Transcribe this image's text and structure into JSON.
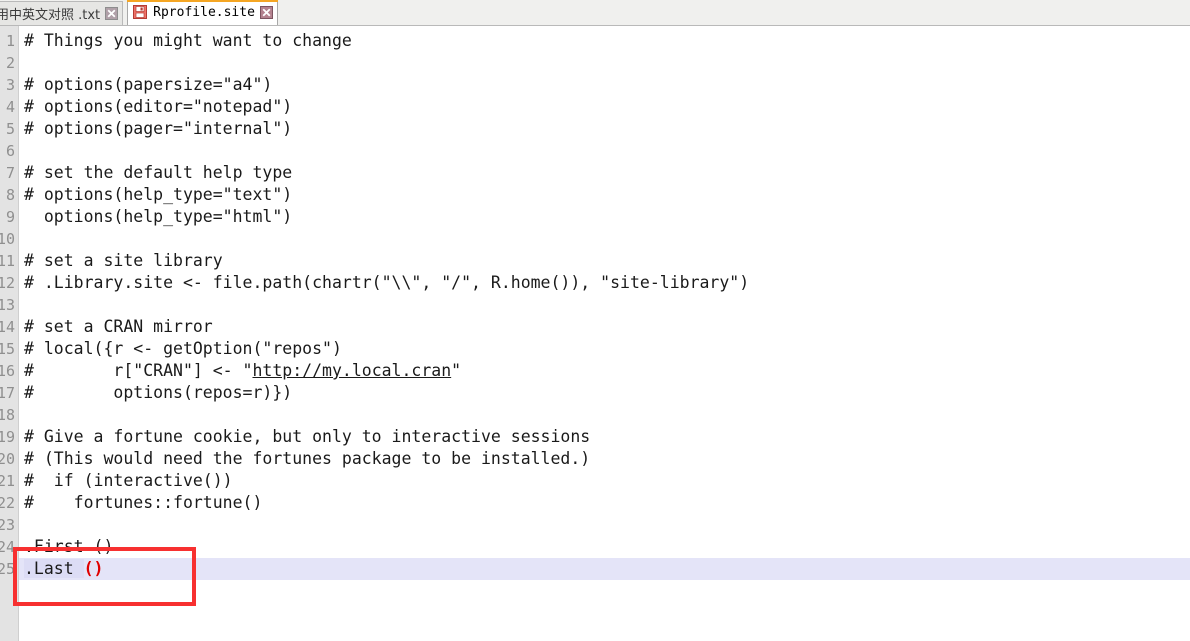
{
  "window": {
    "app_kind": "text-editor",
    "colors": {
      "active_tab_top_accent": "#f5a623",
      "current_line_highlight": "#e4e4f8",
      "selection": "#dcdcf5",
      "gutter_background": "#e3e3e3",
      "line_number_text": "#8f8f8f",
      "annotation_box": "#f73030",
      "matching_paren": "#e00000",
      "code_text": "#1a1a1a"
    }
  },
  "tabbar": {
    "tabs": [
      {
        "label": "用中英文对照 .txt",
        "active": false,
        "clipped_left": true,
        "close_icon": "close-icon",
        "close_label": "✕"
      },
      {
        "label": "Rprofile.site",
        "active": true,
        "clipped_left": false,
        "file_icon": "save-icon",
        "close_icon": "close-icon",
        "close_label": "✕"
      }
    ]
  },
  "editor": {
    "line_numbers": [
      "1",
      "2",
      "3",
      "4",
      "5",
      "6",
      "7",
      "8",
      "9",
      "10",
      "11",
      "12",
      "13",
      "14",
      "15",
      "16",
      "17",
      "18",
      "19",
      "20",
      "21",
      "22",
      "23",
      "24",
      "25"
    ],
    "lines": [
      {
        "n": "1",
        "text": "# Things you might want to change"
      },
      {
        "n": "2",
        "text": ""
      },
      {
        "n": "3",
        "text": "# options(papersize=\"a4\")"
      },
      {
        "n": "4",
        "text": "# options(editor=\"notepad\")"
      },
      {
        "n": "5",
        "text": "# options(pager=\"internal\")"
      },
      {
        "n": "6",
        "text": ""
      },
      {
        "n": "7",
        "text": "# set the default help type"
      },
      {
        "n": "8",
        "text": "# options(help_type=\"text\")"
      },
      {
        "n": "9",
        "text": "  options(help_type=\"html\")"
      },
      {
        "n": "10",
        "text": ""
      },
      {
        "n": "11",
        "text": "# set a site library"
      },
      {
        "n": "12",
        "text": "# .Library.site <- file.path(chartr(\"\\\\\", \"/\", R.home()), \"site-library\")"
      },
      {
        "n": "13",
        "text": ""
      },
      {
        "n": "14",
        "text": "# set a CRAN mirror"
      },
      {
        "n": "15",
        "text": "# local({r <- getOption(\"repos\")"
      },
      {
        "n": "16",
        "pre": "#        r[\"CRAN\"] <- \"",
        "url": "http://my.local.cran",
        "post": "\""
      },
      {
        "n": "17",
        "text": "#        options(repos=r)})"
      },
      {
        "n": "18",
        "text": ""
      },
      {
        "n": "19",
        "text": "# Give a fortune cookie, but only to interactive sessions"
      },
      {
        "n": "20",
        "text": "# (This would need the fortunes package to be installed.)"
      },
      {
        "n": "21",
        "text": "#  if (interactive())"
      },
      {
        "n": "22",
        "text": "#    fortunes::fortune()"
      },
      {
        "n": "23",
        "text": ""
      },
      {
        "n": "24",
        "text": ".First ()"
      },
      {
        "n": "25",
        "sel_text": ".Last ",
        "paren": "()",
        "current": true
      }
    ]
  },
  "annotation": {
    "box_label": "red-highlight-box",
    "targets": [
      ".First ()",
      ".Last ()"
    ]
  }
}
